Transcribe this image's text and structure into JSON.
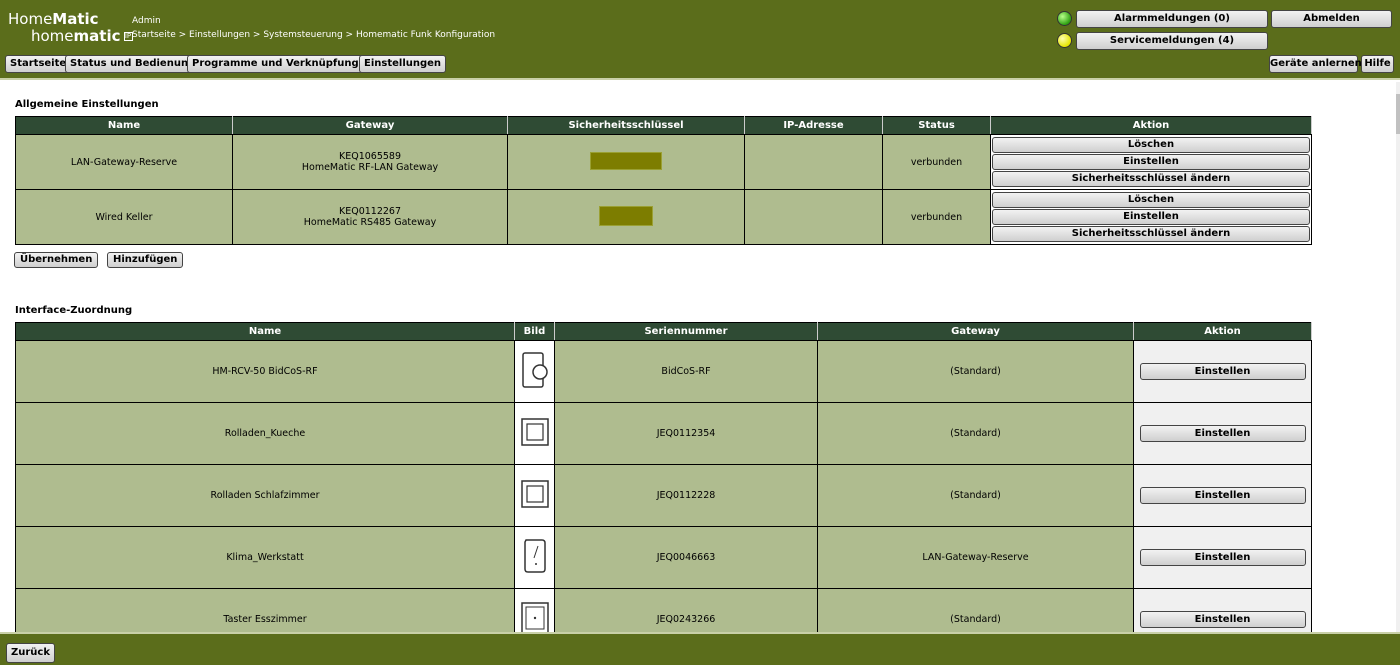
{
  "header": {
    "logo_line1_a": "Home",
    "logo_line1_b": "Matic",
    "logo_line2_a": "home",
    "logo_line2_b": "matic",
    "logo_box": "IP",
    "user": "Admin",
    "breadcrumb": "Startseite > Einstellungen > Systemsteuerung > Homematic Funk Konfiguration",
    "nav": [
      "Startseite",
      "Status und Bedienung",
      "Programme und Verknüpfungen",
      "Einstellungen"
    ],
    "alarm_label": "Alarmmeldungen (0)",
    "service_label": "Servicemeldungen (4)",
    "logout_label": "Abmelden",
    "learn_label": "Geräte anlernen",
    "help_label": "Hilfe",
    "colors": {
      "bar": "#5b6d1b",
      "led_alarm": "#2ea011",
      "led_service": "#e6e600"
    }
  },
  "general": {
    "title": "Allgemeine Einstellungen",
    "columns": [
      "Name",
      "Gateway",
      "Sicherheitsschlüssel",
      "IP-Adresse",
      "Status",
      "Aktion"
    ],
    "rows": [
      {
        "name": "LAN-Gateway-Reserve",
        "gw_serial": "KEQ1065589",
        "gw_type": "HomeMatic RF-LAN Gateway",
        "ip": "",
        "status": "verbunden",
        "actions": [
          "Löschen",
          "Einstellen",
          "Sicherheitsschlüssel ändern"
        ]
      },
      {
        "name": "Wired Keller",
        "gw_serial": "KEQ0112267",
        "gw_type": "HomeMatic RS485 Gateway",
        "ip": "",
        "status": "verbunden",
        "actions": [
          "Löschen",
          "Einstellen",
          "Sicherheitsschlüssel ändern"
        ]
      }
    ],
    "apply_label": "Übernehmen",
    "add_label": "Hinzufügen"
  },
  "interfaces": {
    "title": "Interface-Zuordnung",
    "columns": [
      "Name",
      "Bild",
      "Seriennummer",
      "Gateway",
      "Aktion"
    ],
    "rows": [
      {
        "name": "HM-RCV-50 BidCoS-RF",
        "image": "receiver-device-icon",
        "serial": "BidCoS-RF",
        "gateway": "(Standard)",
        "action": "Einstellen"
      },
      {
        "name": "Rolladen_Kueche",
        "image": "flush-switch-icon",
        "serial": "JEQ0112354",
        "gateway": "(Standard)",
        "action": "Einstellen"
      },
      {
        "name": "Rolladen Schlafzimmer",
        "image": "flush-switch-icon",
        "serial": "JEQ0112228",
        "gateway": "(Standard)",
        "action": "Einstellen"
      },
      {
        "name": "Klima_Werkstatt",
        "image": "climate-sensor-icon",
        "serial": "JEQ0046663",
        "gateway": "LAN-Gateway-Reserve",
        "action": "Einstellen"
      },
      {
        "name": "Taster Esszimmer",
        "image": "push-button-icon",
        "serial": "JEQ0243266",
        "gateway": "(Standard)",
        "action": "Einstellen"
      }
    ]
  },
  "footer": {
    "back_label": "Zurück"
  }
}
